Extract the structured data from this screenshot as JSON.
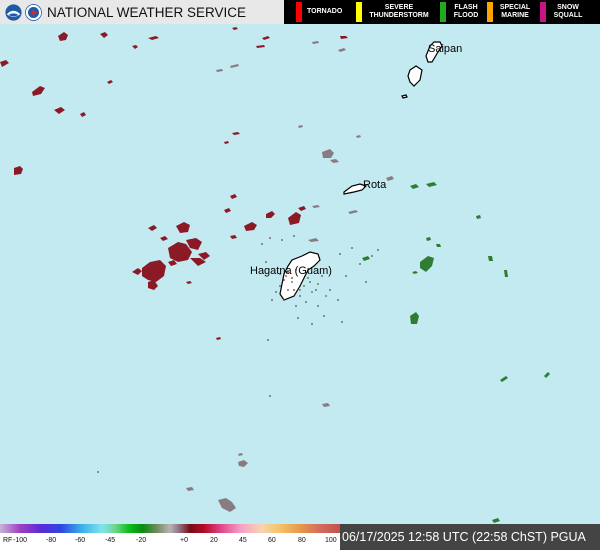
{
  "header": {
    "title": "NATIONAL WEATHER SERVICE"
  },
  "warnings": [
    {
      "label": "TORNADO",
      "color": "#ff0000"
    },
    {
      "label": "SEVERE THUNDERSTORM",
      "color": "#ffff00"
    },
    {
      "label": "FLASH FLOOD",
      "color": "#22aa22"
    },
    {
      "label": "SPECIAL MARINE",
      "color": "#ffa500"
    },
    {
      "label": "SNOW SQUALL",
      "color": "#c71585"
    }
  ],
  "places": {
    "saipan": "Saipan",
    "rota": "Rota",
    "hagatna": "Hagatna (Guam)"
  },
  "legend": {
    "ticks": [
      "RF",
      "-100",
      "-80",
      "-60",
      "-45",
      "-20",
      "+0",
      "20",
      "45",
      "60",
      "80",
      "100"
    ]
  },
  "timestamp": "06/17/2025 12:58 UTC (22:58 ChST) PGUA",
  "colors": {
    "ocean": "#c4eaf1",
    "inbound": "#8b1a26",
    "outbound": "#2e7d32",
    "neutral": "#7a6a70"
  }
}
